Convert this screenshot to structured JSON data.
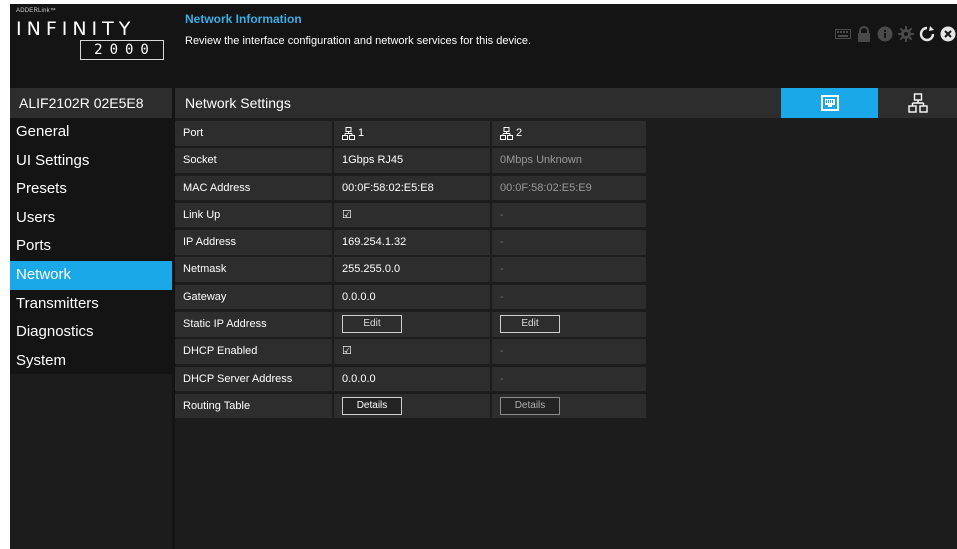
{
  "logo": {
    "small": "ADDERLink™",
    "main": "INFINITY",
    "number": "2000"
  },
  "header": {
    "title": "Network Information",
    "subtitle": "Review the interface configuration and network services for this device.",
    "icons": [
      "keyboard-icon",
      "lock-icon",
      "info-icon",
      "settings-icon",
      "refresh-icon",
      "close-icon"
    ]
  },
  "device_name": "ALIF2102R 02E5E8",
  "section_title": "Network Settings",
  "sidebar": {
    "items": [
      {
        "label": "General",
        "active": false
      },
      {
        "label": "UI Settings",
        "active": false
      },
      {
        "label": "Presets",
        "active": false
      },
      {
        "label": "Users",
        "active": false
      },
      {
        "label": "Ports",
        "active": false
      },
      {
        "label": "Network",
        "active": true
      },
      {
        "label": "Transmitters",
        "active": false
      },
      {
        "label": "Diagnostics",
        "active": false
      },
      {
        "label": "System",
        "active": false
      }
    ]
  },
  "table": {
    "header": {
      "label": "Port",
      "port1": "1",
      "port2": "2"
    },
    "rows": {
      "socket": {
        "label": "Socket",
        "p1": "1Gbps RJ45",
        "p2": "0Mbps Unknown"
      },
      "mac": {
        "label": "MAC Address",
        "p1": "00:0F:58:02:E5:E8",
        "p2": "00:0F:58:02:E5:E9"
      },
      "link": {
        "label": "Link Up",
        "p1": "☑",
        "p2": "-"
      },
      "ip": {
        "label": "IP Address",
        "p1": "169.254.1.32",
        "p2": "-"
      },
      "netmask": {
        "label": "Netmask",
        "p1": "255.255.0.0",
        "p2": "-"
      },
      "gateway": {
        "label": "Gateway",
        "p1": "0.0.0.0",
        "p2": "-"
      },
      "static": {
        "label": "Static IP Address",
        "p1": "Edit",
        "p2": "Edit"
      },
      "dhcp": {
        "label": "DHCP Enabled",
        "p1": "☑",
        "p2": "-"
      },
      "dhcp_server": {
        "label": "DHCP Server Address",
        "p1": "0.0.0.0",
        "p2": "-"
      },
      "routing": {
        "label": "Routing Table",
        "p1": "Details",
        "p2": "Details"
      }
    }
  },
  "colors": {
    "accent": "#1aa8e8",
    "title": "#3aaee6",
    "background": "#141414",
    "panel": "#2d2d2d"
  }
}
